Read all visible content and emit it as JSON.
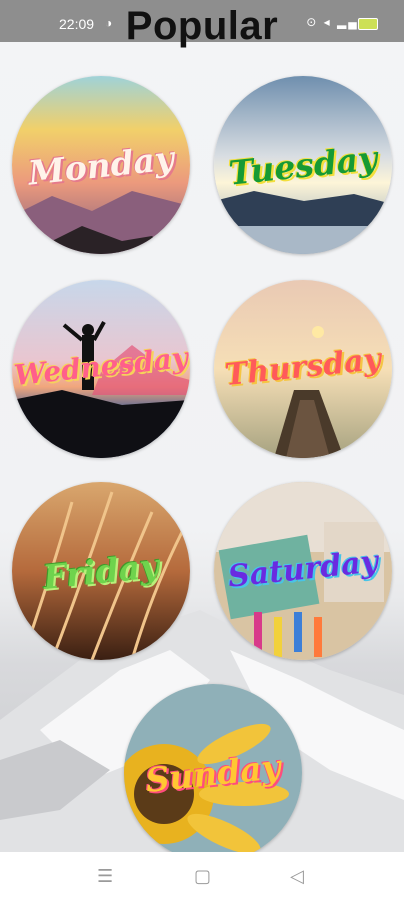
{
  "status_bar": {
    "time": "22:09"
  },
  "header": {
    "title": "Popular"
  },
  "days": [
    {
      "label": "Monday",
      "text_color": "#fff3ea",
      "stroke_color": "#e57a8c"
    },
    {
      "label": "Tuesday",
      "text_color": "#169a34",
      "stroke_color": "#f3df3c"
    },
    {
      "label": "Wednesday",
      "text_color": "#ff5f8b",
      "stroke_color": "#f6d35a"
    },
    {
      "label": "Thursday",
      "text_color": "#ff5a5a",
      "stroke_color": "#f5c542"
    },
    {
      "label": "Friday",
      "text_color": "#6fd34d",
      "stroke_color": "#b9f07a"
    },
    {
      "label": "Saturday",
      "text_color": "#6a2be0",
      "stroke_color": "#48c4e8"
    },
    {
      "label": "Sunday",
      "text_color": "#ffc733",
      "stroke_color": "#ff4c7d"
    }
  ],
  "nav": {
    "menu_icon": "menu-icon",
    "home_icon": "home-icon",
    "back_icon": "back-icon"
  }
}
